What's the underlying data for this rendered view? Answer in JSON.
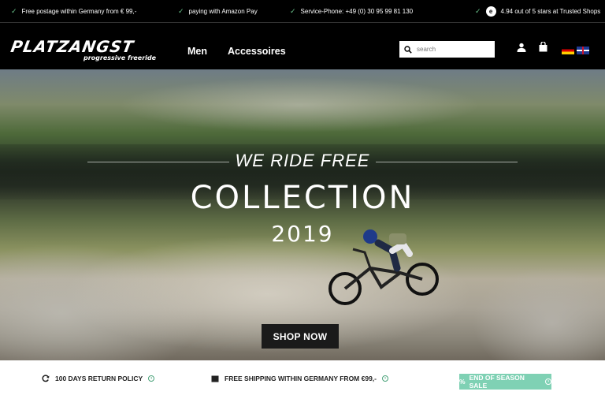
{
  "topbar": {
    "usp_1": "Free postage within Germany from € 99,-",
    "usp_2": "paying with Amazon Pay",
    "usp_3": "Service-Phone: +49 (0) 30 95 99 81 130",
    "rating": "4.94 out of 5 stars at Trusted Shops",
    "check_color": "#6ac48c"
  },
  "header": {
    "logo_main": "PLATZANGST",
    "logo_sub": "progressive freeride",
    "nav": [
      "Men",
      "Accessoires"
    ],
    "search_placeholder": "search",
    "languages": [
      "de",
      "en"
    ]
  },
  "hero": {
    "tagline": "WE RIDE FREE",
    "title": "COLLECTION",
    "year": "2019",
    "cta": "SHOP NOW"
  },
  "usp_bar": {
    "return_policy": "100 DAYS RETURN POLICY",
    "free_shipping": "FREE SHIPPING WITHIN GERMANY FROM €99,-",
    "sale": "END OF SEASON SALE",
    "sale_color": "#7fd1b4",
    "accent": "#4aa37a"
  }
}
